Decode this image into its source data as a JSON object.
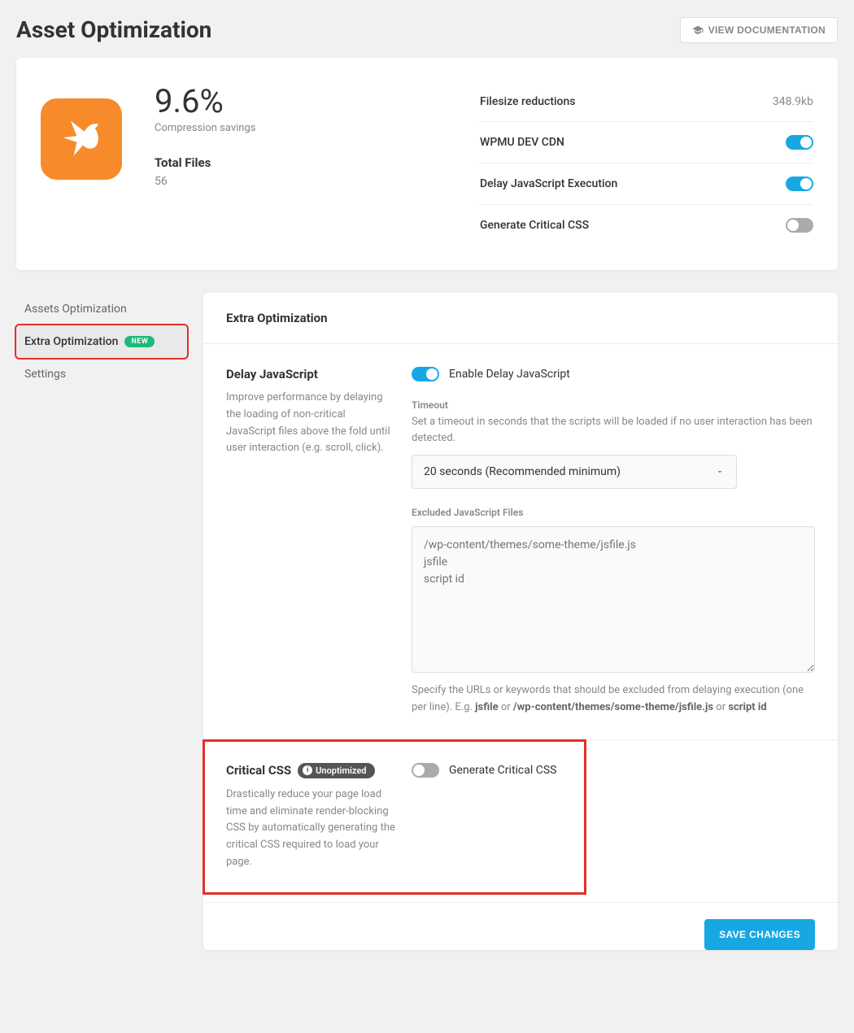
{
  "header": {
    "title": "Asset Optimization",
    "doc_button": "VIEW DOCUMENTATION"
  },
  "summary": {
    "percent": "9.6%",
    "percent_label": "Compression savings",
    "total_files_label": "Total Files",
    "total_files_value": "56",
    "rows": [
      {
        "label": "Filesize reductions",
        "value": "348.9kb",
        "type": "text"
      },
      {
        "label": "WPMU DEV CDN",
        "enabled": true,
        "type": "toggle"
      },
      {
        "label": "Delay JavaScript Execution",
        "enabled": true,
        "type": "toggle"
      },
      {
        "label": "Generate Critical CSS",
        "enabled": false,
        "type": "toggle"
      }
    ]
  },
  "sidebar": {
    "items": [
      {
        "label": "Assets Optimization",
        "active": false,
        "badge": null
      },
      {
        "label": "Extra Optimization",
        "active": true,
        "badge": "NEW"
      },
      {
        "label": "Settings",
        "active": false,
        "badge": null
      }
    ]
  },
  "content": {
    "title": "Extra Optimization",
    "delay_js": {
      "label": "Delay JavaScript",
      "desc": "Improve performance by delaying the loading of non-critical JavaScript files above the fold until user interaction (e.g. scroll, click).",
      "toggle_label": "Enable Delay JavaScript",
      "toggle_enabled": true,
      "timeout_label": "Timeout",
      "timeout_hint": "Set a timeout in seconds that the scripts will be loaded if no user interaction has been detected.",
      "timeout_value": "20 seconds (Recommended minimum)",
      "excluded_label": "Excluded JavaScript Files",
      "excluded_placeholder": "/wp-content/themes/some-theme/jsfile.js\njsfile\nscript id",
      "excluded_hint_pre": "Specify the URLs or keywords that should be excluded from delaying execution (one per line). E.g. ",
      "excluded_hint_ex1": "jsfile",
      "excluded_hint_mid": " or ",
      "excluded_hint_ex2": "/wp-content/themes/some-theme/jsfile.js",
      "excluded_hint_mid2": " or ",
      "excluded_hint_ex3": "script id"
    },
    "critical_css": {
      "label": "Critical CSS",
      "badge": "Unoptimized",
      "desc": "Drastically reduce your page load time and eliminate render-blocking CSS by automatically generating the critical CSS required to load your page.",
      "toggle_label": "Generate Critical CSS",
      "toggle_enabled": false
    },
    "save_button": "SAVE CHANGES"
  }
}
